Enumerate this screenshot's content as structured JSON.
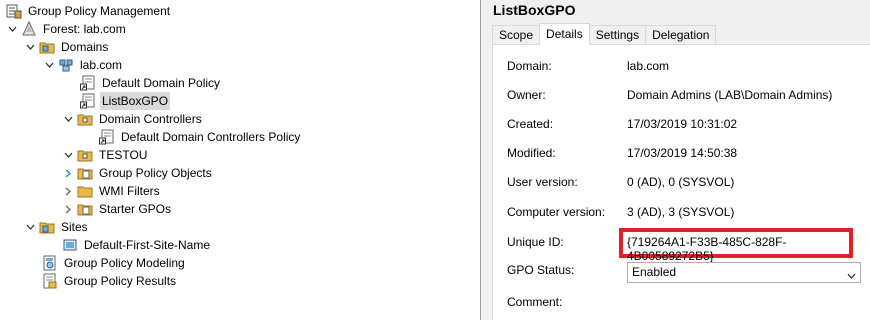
{
  "tree": {
    "root": "Group Policy Management",
    "forest": "Forest: lab.com",
    "domains": "Domains",
    "domain": "lab.com",
    "default_domain_policy": "Default Domain Policy",
    "listbox_gpo": "ListBoxGPO",
    "domain_controllers": "Domain Controllers",
    "default_dc_policy": "Default Domain Controllers Policy",
    "testou": "TESTOU",
    "gpo_objects": "Group Policy Objects",
    "wmi_filters": "WMI Filters",
    "starter_gpos": "Starter GPOs",
    "sites": "Sites",
    "default_site": "Default-First-Site-Name",
    "modeling": "Group Policy Modeling",
    "results": "Group Policy Results"
  },
  "details": {
    "title": "ListBoxGPO",
    "tabs": [
      "Scope",
      "Details",
      "Settings",
      "Delegation"
    ],
    "active_tab": "Details",
    "fields": {
      "domain_label": "Domain:",
      "domain_value": "lab.com",
      "owner_label": "Owner:",
      "owner_value": "Domain Admins (LAB\\Domain Admins)",
      "created_label": "Created:",
      "created_value": "17/03/2019 10:31:02",
      "modified_label": "Modified:",
      "modified_value": "17/03/2019 14:50:38",
      "user_version_label": "User version:",
      "user_version_value": "0 (AD), 0 (SYSVOL)",
      "computer_version_label": "Computer version:",
      "computer_version_value": "3 (AD), 3 (SYSVOL)",
      "unique_id_label": "Unique ID:",
      "unique_id_value": "{719264A1-F33B-485C-828F-4B00589272B5}",
      "gpo_status_label": "GPO Status:",
      "gpo_status_value": "Enabled",
      "comment_label": "Comment:"
    }
  },
  "colors": {
    "highlight_box": "#e0202a",
    "selection": "#d9d9d9",
    "folder": "#e8b94a"
  }
}
